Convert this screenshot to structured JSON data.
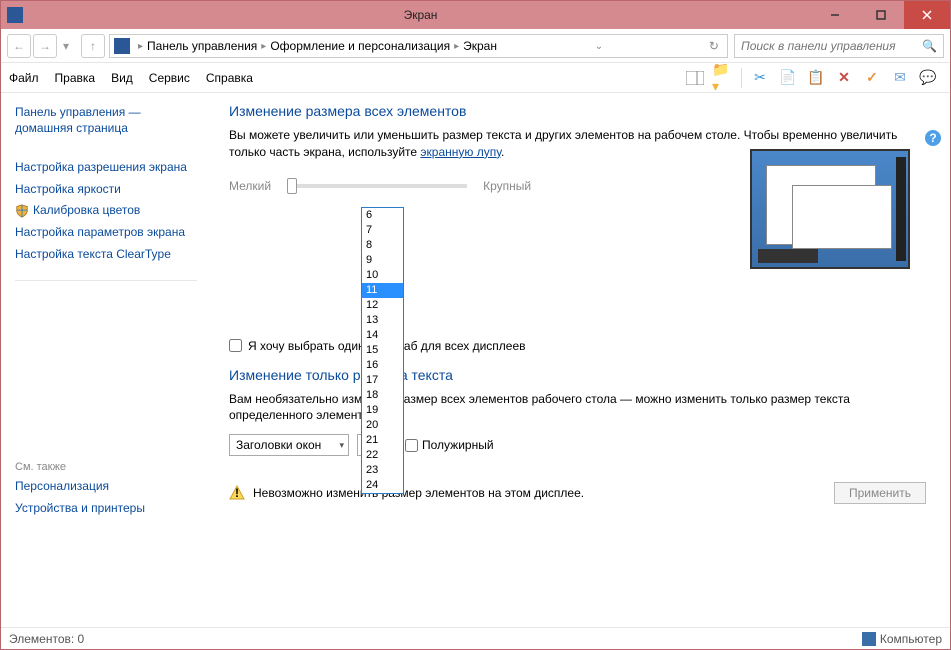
{
  "window": {
    "title": "Экран"
  },
  "breadcrumb": {
    "items": [
      "Панель управления",
      "Оформление и персонализация",
      "Экран"
    ]
  },
  "search": {
    "placeholder": "Поиск в панели управления"
  },
  "menubar": {
    "file": "Файл",
    "edit": "Правка",
    "view": "Вид",
    "service": "Сервис",
    "help": "Справка"
  },
  "sidebar": {
    "home": "Панель управления — домашняя страница",
    "links": {
      "resolution": "Настройка разрешения экрана",
      "brightness": "Настройка яркости",
      "calibrate": "Калибровка цветов",
      "params": "Настройка параметров экрана",
      "cleartype": "Настройка текста ClearType"
    },
    "seealso": "См. также",
    "related": {
      "personalization": "Персонализация",
      "devices": "Устройства и принтеры"
    }
  },
  "content": {
    "heading1": "Изменение размера всех элементов",
    "para1a": "Вы можете увеличить или уменьшить размер текста и других элементов на рабочем столе. Чтобы временно увеличить только часть экрана, используйте ",
    "para1_link": "экранную лупу",
    "para1b": ".",
    "slider": {
      "small": "Мелкий",
      "large": "Крупный"
    },
    "checkbox": "Я хочу выбрать один масштаб для всех дисплеев",
    "heading2": "Изменение только размера текста",
    "para2": "Вам необязательно изменять размер всех элементов рабочего стола — можно изменить только размер текста определенного элемента.",
    "select_item": "Заголовки окон",
    "size_value": "11",
    "bold": "Полужирный",
    "warning": "Невозможно изменить размер элементов на этом дисплее.",
    "apply": "Применить"
  },
  "dropdown": {
    "options": [
      "6",
      "7",
      "8",
      "9",
      "10",
      "11",
      "12",
      "13",
      "14",
      "15",
      "16",
      "17",
      "18",
      "19",
      "20",
      "21",
      "22",
      "23",
      "24"
    ],
    "selected": "11"
  },
  "statusbar": {
    "items": "Элементов: 0",
    "computer": "Компьютер"
  }
}
